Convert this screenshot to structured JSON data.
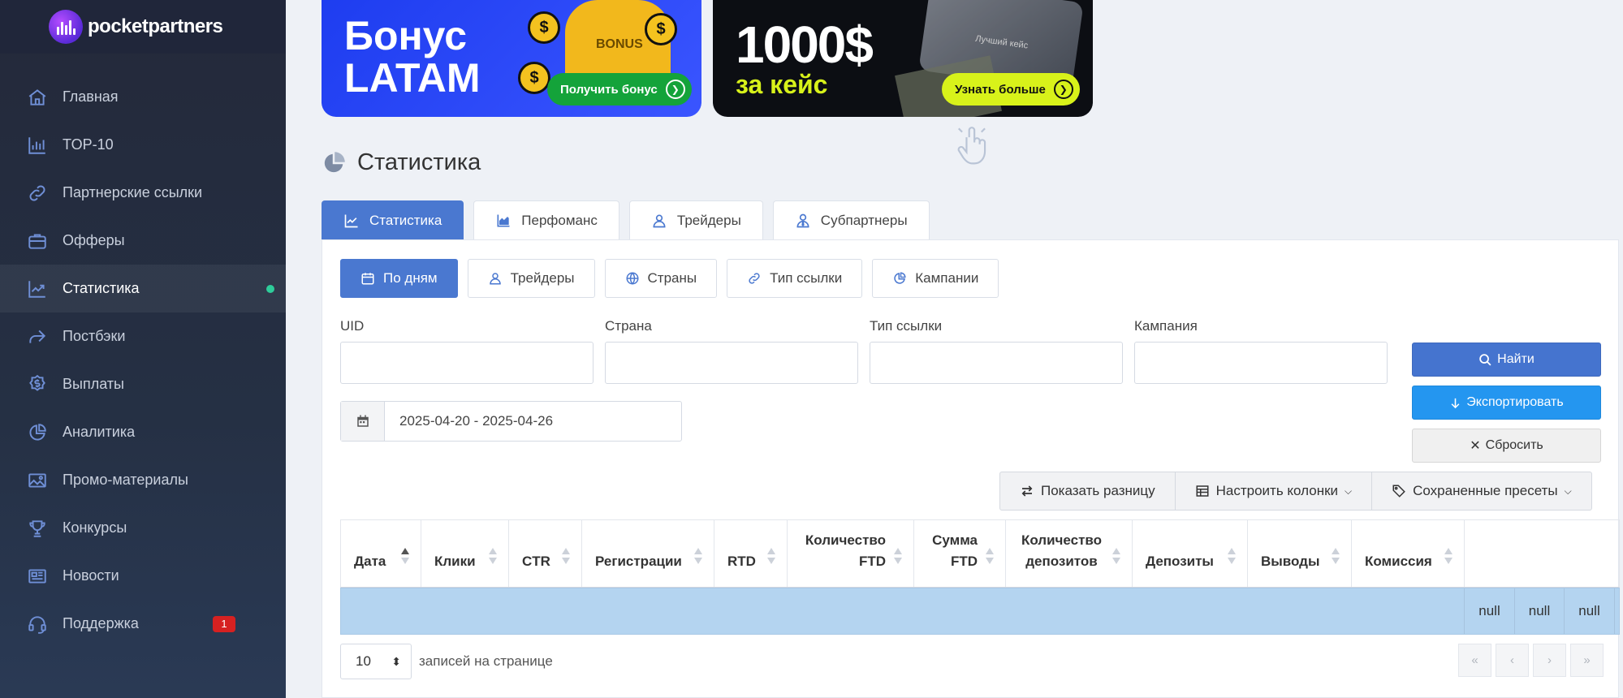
{
  "brand": {
    "name": "pocketpartners"
  },
  "sidebar": {
    "items": [
      {
        "label": "Главная",
        "icon": "home-icon"
      },
      {
        "label": "TOP-10",
        "icon": "bar-chart-icon"
      },
      {
        "label": "Партнерские ссылки",
        "icon": "link-icon"
      },
      {
        "label": "Офферы",
        "icon": "briefcase-icon"
      },
      {
        "label": "Статистика",
        "icon": "line-chart-icon",
        "active": true
      },
      {
        "label": "Постбэки",
        "icon": "share-arrow-icon"
      },
      {
        "label": "Выплаты",
        "icon": "dollar-badge-icon"
      },
      {
        "label": "Аналитика",
        "icon": "pie-chart-icon"
      },
      {
        "label": "Промо-материалы",
        "icon": "image-icon"
      },
      {
        "label": "Конкурсы",
        "icon": "trophy-icon"
      },
      {
        "label": "Новости",
        "icon": "newspaper-icon"
      },
      {
        "label": "Поддержка",
        "icon": "headset-icon",
        "badge": "1"
      }
    ]
  },
  "banners": {
    "first": {
      "title_line1": "Бонус",
      "title_line2": "LATAM",
      "shirt_text": "BONUS",
      "button": "Получить бонус"
    },
    "second": {
      "title": "1000$",
      "subtitle": "за кейс",
      "card_text": "Лучший кейс",
      "button": "Узнать больше"
    }
  },
  "page": {
    "title": "Статистика"
  },
  "tabs": [
    {
      "label": "Статистика",
      "icon": "line-chart-icon",
      "active": true
    },
    {
      "label": "Перфоманс",
      "icon": "area-chart-icon"
    },
    {
      "label": "Трейдеры",
      "icon": "user-icon"
    },
    {
      "label": "Субпартнеры",
      "icon": "user-tie-icon"
    }
  ],
  "subtabs": [
    {
      "label": "По дням",
      "icon": "calendar-icon",
      "active": true
    },
    {
      "label": "Трейдеры",
      "icon": "user-icon"
    },
    {
      "label": "Страны",
      "icon": "globe-icon"
    },
    {
      "label": "Тип ссылки",
      "icon": "link-icon"
    },
    {
      "label": "Кампании",
      "icon": "pie-chart-icon"
    }
  ],
  "filters": {
    "uid": {
      "label": "UID",
      "value": ""
    },
    "country": {
      "label": "Страна",
      "value": ""
    },
    "link_type": {
      "label": "Тип ссылки",
      "value": ""
    },
    "campaign": {
      "label": "Кампания",
      "value": ""
    },
    "date_range": "2025-04-20 - 2025-04-26"
  },
  "actions": {
    "find": "Найти",
    "export": "Экспортировать",
    "reset": "Сбросить"
  },
  "tools": {
    "show_diff": "Показать разницу",
    "columns": "Настроить колонки",
    "presets": "Сохраненные пресеты"
  },
  "table": {
    "columns": [
      {
        "label": "Дата",
        "sort": "asc"
      },
      {
        "label": "Клики"
      },
      {
        "label": "CTR"
      },
      {
        "label": "Регистрации"
      },
      {
        "label": "RTD"
      },
      {
        "label": "Количество FTD"
      },
      {
        "label": "Сумма FTD"
      },
      {
        "label": "Количество депозитов"
      },
      {
        "label": "Депозиты"
      },
      {
        "label": "Выводы"
      },
      {
        "label": "Комиссия"
      }
    ],
    "row": [
      "null",
      "null",
      "null"
    ]
  },
  "footer": {
    "per_page_value": "10",
    "per_page_label": "записей на странице",
    "pager": [
      "«",
      "‹",
      "›",
      "»"
    ]
  },
  "colors": {
    "accent": "#4a78d0",
    "export": "#2496f0",
    "row_highlight": "#b4d4f0",
    "sidebar_bg": "#24293a",
    "active_dot": "#2ecc9a",
    "badge": "#d62121"
  }
}
